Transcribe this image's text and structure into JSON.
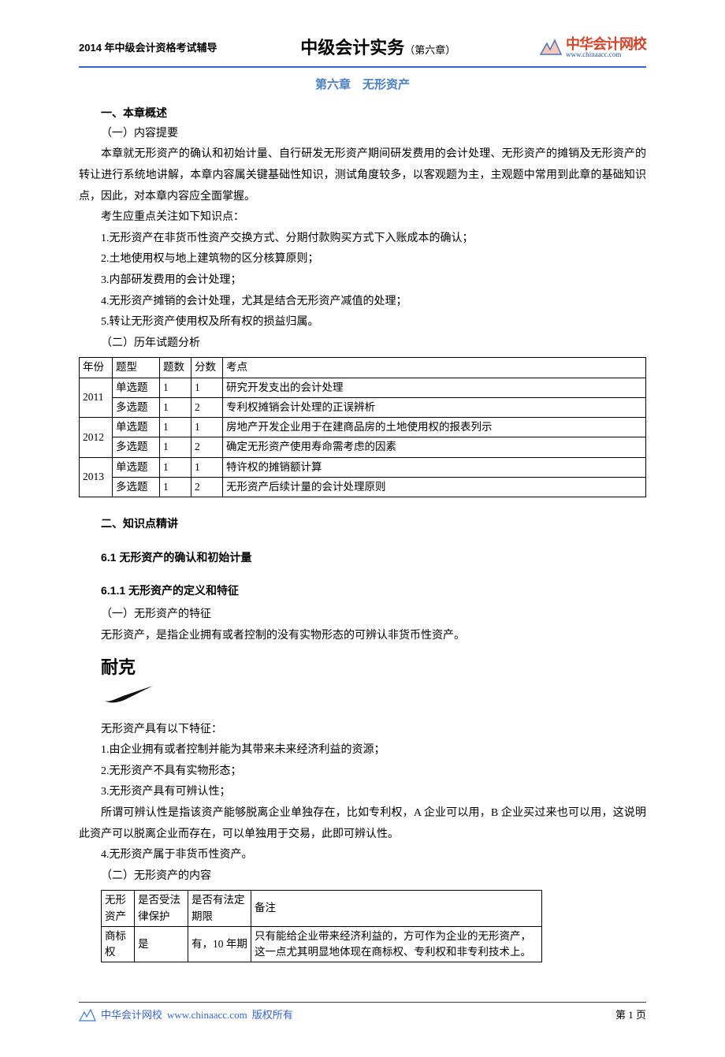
{
  "header": {
    "left": "2014 年中级会计资格考试辅导",
    "center_main": "中级会计实务",
    "center_small": "（第六章）",
    "logo_cn": "中华会计网校",
    "logo_url": "www.chinaacc.com"
  },
  "chapter_title": "第六章　无形资产",
  "s1": {
    "heading": "一、本章概述",
    "sub1": "（一）内容提要",
    "para1": "本章就无形资产的确认和初始计量、自行研发无形资产期间研发费用的会计处理、无形资产的摊销及无形资产的转让进行系统地讲解，本章内容属关键基础性知识，测试角度较多，以客观题为主，主观题中常用到此章的基础知识点，因此，对本章内容应全面掌握。",
    "para2": "考生应重点关注如下知识点：",
    "li1": "1.无形资产在非货币性资产交换方式、分期付款购买方式下入账成本的确认；",
    "li2": "2.土地使用权与地上建筑物的区分核算原则；",
    "li3": "3.内部研发费用的会计处理；",
    "li4": "4.无形资产摊销的会计处理，尤其是结合无形资产减值的处理；",
    "li5": "5.转让无形资产使用权及所有权的损益归属。",
    "sub2": "（二）历年试题分析"
  },
  "table1": {
    "headers": {
      "year": "年份",
      "type": "题型",
      "count": "题数",
      "score": "分数",
      "point": "考点"
    },
    "rows": [
      {
        "year": "2011",
        "type": "单选题",
        "count": "1",
        "score": "1",
        "point": "研究开发支出的会计处理"
      },
      {
        "year": "",
        "type": "多选题",
        "count": "1",
        "score": "2",
        "point": "专利权摊销会计处理的正误辨析"
      },
      {
        "year": "2012",
        "type": "单选题",
        "count": "1",
        "score": "1",
        "point": "房地产开发企业用于在建商品房的土地使用权的报表列示"
      },
      {
        "year": "",
        "type": "多选题",
        "count": "1",
        "score": "2",
        "point": "确定无形资产使用寿命需考虑的因素"
      },
      {
        "year": "2013",
        "type": "单选题",
        "count": "1",
        "score": "1",
        "point": "特许权的摊销额计算"
      },
      {
        "year": "",
        "type": "多选题",
        "count": "1",
        "score": "2",
        "point": "无形资产后续计量的会计处理原则"
      }
    ]
  },
  "s2": {
    "heading": "二、知识点精讲",
    "h61": "6.1 无形资产的确认和初始计量",
    "h611": "6.1.1 无形资产的定义和特征",
    "sub1": "（一）无形资产的特征",
    "def": "无形资产，是指企业拥有或者控制的没有实物形态的可辨认非货币性资产。",
    "brand": "耐克",
    "feat_intro": "无形资产具有以下特征：",
    "f1": "1.由企业拥有或者控制并能为其带来未来经济利益的资源；",
    "f2": "2.无形资产不具有实物形态；",
    "f3": "3.无形资产具有可辨认性；",
    "explain": "所谓可辨认性是指该资产能够脱离企业单独存在，比如专利权，A 企业可以用，B 企业买过来也可以用，这说明此资产可以脱离企业而存在，可以单独用于交易，此即可辨认性。",
    "f4": "4.无形资产属于非货币性资产。",
    "sub2": "（二）无形资产的内容"
  },
  "table2": {
    "headers": {
      "name": "无形资产",
      "legal": "是否受法律保护",
      "term": "是否有法定期限",
      "note": "备注"
    },
    "rows": [
      {
        "name": "商标权",
        "legal": "是",
        "term": "有，10 年期",
        "note": "只有能给企业带来经济利益的，方可作为企业的无形资产，这一点尤其明显地体现在商标权、专利权和非专利技术上。"
      }
    ]
  },
  "footer": {
    "brand": "中华会计网校",
    "url_text": "www.chinaacc.com",
    "copyright": "版权所有",
    "page": "第 1 页"
  }
}
